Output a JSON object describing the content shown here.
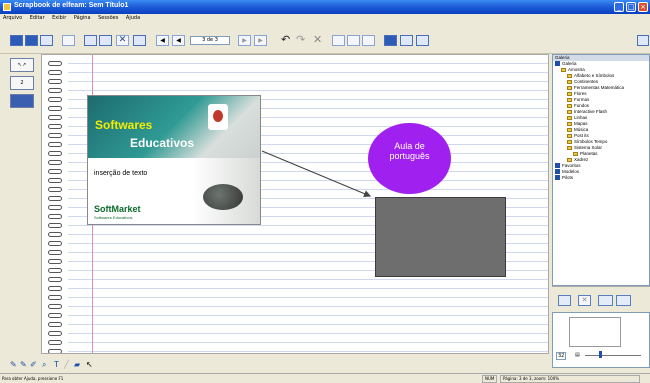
{
  "window": {
    "title": "Scrapbook de elfeam: Sem Título1"
  },
  "menu": [
    "Arquivo",
    "Editar",
    "Exibir",
    "Página",
    "Sessões",
    "Ajuda"
  ],
  "toolbar": {
    "page_indicator": "3 de 3"
  },
  "left_tools": [
    {
      "icon": "select-arrow-icon",
      "label": ""
    },
    {
      "icon": "page-2-icon",
      "label": "2"
    },
    {
      "icon": "page-view-icon",
      "label": ""
    }
  ],
  "canvas": {
    "image_card": {
      "title_line1": "Softwares",
      "title_line2": "Educativos",
      "text": "inserção de texto",
      "logo": "SoftMarket",
      "logo_sub": "Softwares Educativos"
    },
    "circle": {
      "line1": "Aula de",
      "line2": "português"
    },
    "colors": {
      "circle": "#a021ef",
      "rectangle": "#6e6e6e",
      "arrow": "#444444"
    }
  },
  "gallery": {
    "items": [
      {
        "label": "Galeria",
        "level": 0,
        "type": "header"
      },
      {
        "label": "Galeria",
        "level": 0,
        "type": "checked"
      },
      {
        "label": "Amostra",
        "level": 1,
        "type": "folder"
      },
      {
        "label": "Alfabeto e Símbolos",
        "level": 2,
        "type": "folder"
      },
      {
        "label": "Continentes",
        "level": 2,
        "type": "folder"
      },
      {
        "label": "Ferramentas Matemática",
        "level": 2,
        "type": "folder"
      },
      {
        "label": "Flores",
        "level": 2,
        "type": "folder"
      },
      {
        "label": "Formas",
        "level": 2,
        "type": "folder"
      },
      {
        "label": "Fundos",
        "level": 2,
        "type": "folder"
      },
      {
        "label": "Interactive Flash",
        "level": 2,
        "type": "folder"
      },
      {
        "label": "Linhas",
        "level": 2,
        "type": "folder"
      },
      {
        "label": "Mapas",
        "level": 2,
        "type": "folder"
      },
      {
        "label": "Música",
        "level": 2,
        "type": "folder"
      },
      {
        "label": "Post its",
        "level": 2,
        "type": "folder"
      },
      {
        "label": "Símbolos Tempo",
        "level": 2,
        "type": "folder"
      },
      {
        "label": "Sistema Solar",
        "level": 2,
        "type": "folder"
      },
      {
        "label": "Planetas",
        "level": 3,
        "type": "folder"
      },
      {
        "label": "Xadrez",
        "level": 2,
        "type": "folder"
      },
      {
        "label": "Favoritos",
        "level": 0,
        "type": "checked"
      },
      {
        "label": "Modelos",
        "level": 0,
        "type": "checked"
      },
      {
        "label": "Pilots",
        "level": 0,
        "type": "checked"
      }
    ]
  },
  "preview": {
    "zoom_label": "32"
  },
  "status": {
    "left": "Para obter Ajuda, pressione F1",
    "page": "Página: 3 de 3, zoom: 100%",
    "num": "NUM"
  }
}
